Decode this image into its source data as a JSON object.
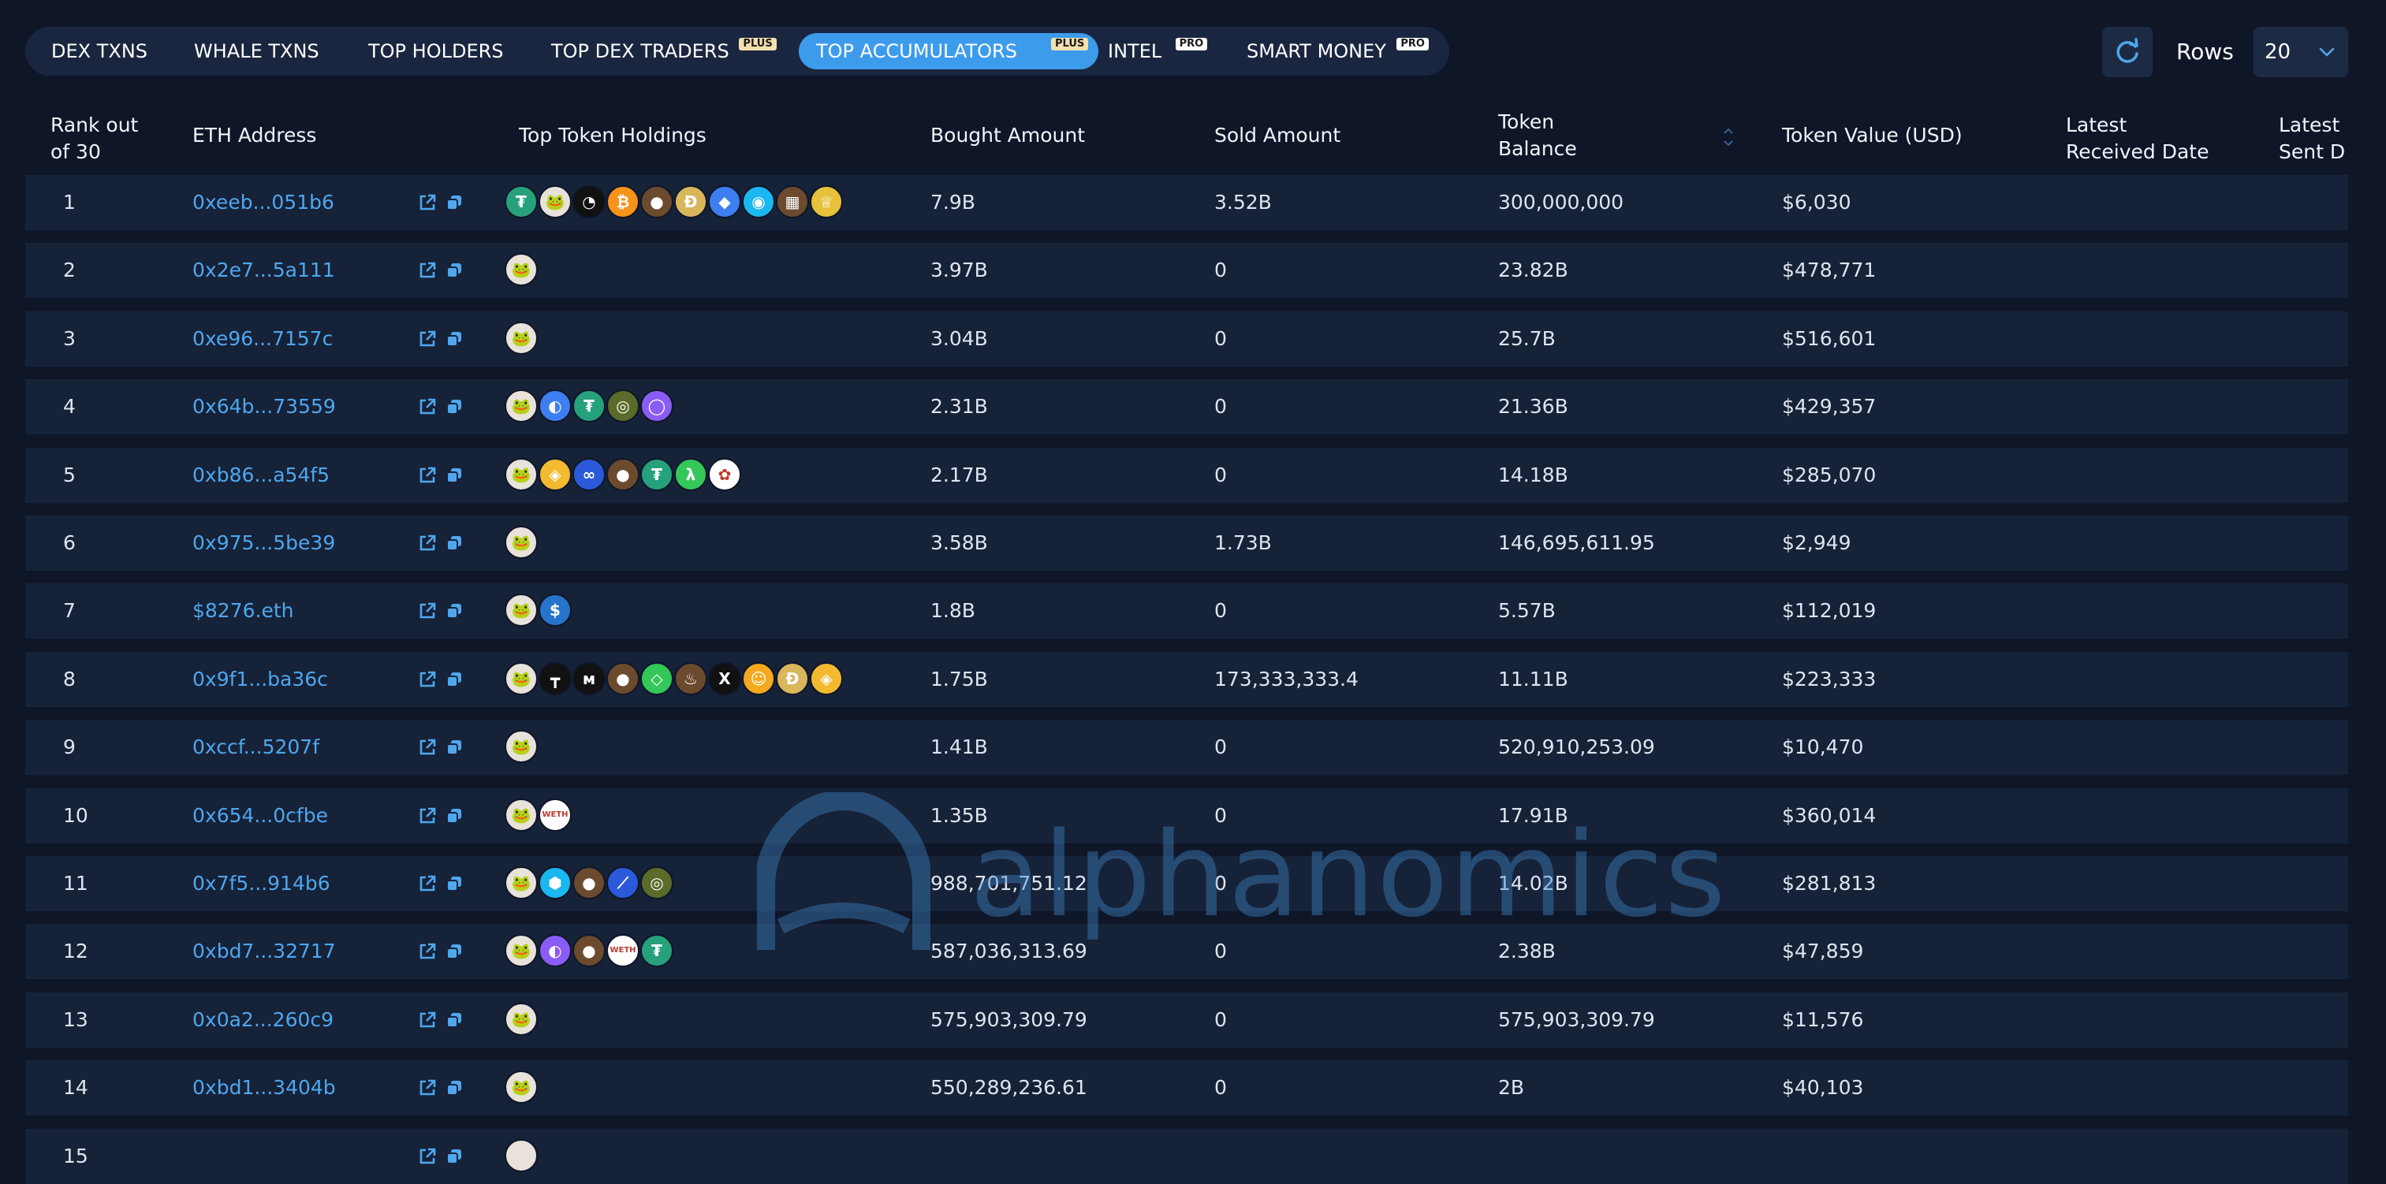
{
  "tabs": [
    {
      "label": "DEX TXNS",
      "badge": "",
      "active": false
    },
    {
      "label": "WHALE TXNS",
      "badge": "",
      "active": false
    },
    {
      "label": "TOP HOLDERS",
      "badge": "",
      "active": false
    },
    {
      "label": "TOP DEX TRADERS",
      "badge": "PLUS",
      "active": false
    },
    {
      "label": "TOP ACCUMULATORS",
      "badge": "PLUS",
      "active": true
    },
    {
      "label": "INTEL",
      "badge": "PRO",
      "active": false
    },
    {
      "label": "SMART MONEY",
      "badge": "PRO",
      "active": false
    }
  ],
  "controls": {
    "refresh_icon": "refresh-icon",
    "rows_label": "Rows",
    "rows_value": "20"
  },
  "columns": {
    "rank": [
      "Rank out",
      "of 30"
    ],
    "address": "ETH Address",
    "holdings": "Top Token Holdings",
    "bought": "Bought Amount",
    "sold": "Sold Amount",
    "balance": [
      "Token",
      "Balance"
    ],
    "value": "Token Value (USD)",
    "received": [
      "Latest",
      "Received Date"
    ],
    "sent": [
      "Latest",
      "Sent D"
    ]
  },
  "icons": {
    "external_link": "external-link-icon",
    "copy": "copy-icon"
  },
  "token_palette": {
    "pepe": "#e8e2da",
    "tether": "#26a17b",
    "bitcoin": "#f7931a",
    "binance": "#f3ba2f",
    "weth": "#ffffff",
    "usdc": "#2775ca",
    "chainlink": "#2a5ada",
    "doge": "#d9b65b",
    "shiba": "#f4a91e",
    "dark": "#111111",
    "blue": "#3d7ff0",
    "cyan": "#1bb7f0",
    "green": "#34c759",
    "purple": "#8a5cf6",
    "olive": "#5a6b2a",
    "brown": "#6b4a2e",
    "gold": "#e7c13a"
  },
  "rows": [
    {
      "rank": "1",
      "address": "0xeeb...051b6",
      "bought": "7.9B",
      "sold": "3.52B",
      "balance": "300,000,000",
      "value": "$6,030",
      "tokens": [
        [
          "tether",
          "₮"
        ],
        [
          "pepe",
          "🐸"
        ],
        [
          "dark",
          "◔"
        ],
        [
          "bitcoin",
          "₿"
        ],
        [
          "brown",
          "●"
        ],
        [
          "doge",
          "Ð"
        ],
        [
          "blue",
          "◆"
        ],
        [
          "cyan",
          "◉"
        ],
        [
          "brown",
          "▦"
        ],
        [
          "gold",
          "♕"
        ]
      ]
    },
    {
      "rank": "2",
      "address": "0x2e7...5a111",
      "bought": "3.97B",
      "sold": "0",
      "balance": "23.82B",
      "value": "$478,771",
      "tokens": [
        [
          "pepe",
          "🐸"
        ]
      ]
    },
    {
      "rank": "3",
      "address": "0xe96...7157c",
      "bought": "3.04B",
      "sold": "0",
      "balance": "25.7B",
      "value": "$516,601",
      "tokens": [
        [
          "pepe",
          "🐸"
        ]
      ]
    },
    {
      "rank": "4",
      "address": "0x64b...73559",
      "bought": "2.31B",
      "sold": "0",
      "balance": "21.36B",
      "value": "$429,357",
      "tokens": [
        [
          "pepe",
          "🐸"
        ],
        [
          "blue",
          "◐"
        ],
        [
          "tether",
          "₮"
        ],
        [
          "olive",
          "◎"
        ],
        [
          "purple",
          "◯"
        ]
      ]
    },
    {
      "rank": "5",
      "address": "0xb86...a54f5",
      "bought": "2.17B",
      "sold": "0",
      "balance": "14.18B",
      "value": "$285,070",
      "tokens": [
        [
          "pepe",
          "🐸"
        ],
        [
          "binance",
          "◈"
        ],
        [
          "chainlink",
          "∞"
        ],
        [
          "brown",
          "●"
        ],
        [
          "tether",
          "₮"
        ],
        [
          "green",
          "λ"
        ],
        [
          "weth",
          "✿"
        ]
      ]
    },
    {
      "rank": "6",
      "address": "0x975...5be39",
      "bought": "3.58B",
      "sold": "1.73B",
      "balance": "146,695,611.95",
      "value": "$2,949",
      "tokens": [
        [
          "pepe",
          "🐸"
        ]
      ]
    },
    {
      "rank": "7",
      "address": "$8276.eth",
      "bought": "1.8B",
      "sold": "0",
      "balance": "5.57B",
      "value": "$112,019",
      "tokens": [
        [
          "pepe",
          "🐸"
        ],
        [
          "usdc",
          "$"
        ]
      ]
    },
    {
      "rank": "8",
      "address": "0x9f1...ba36c",
      "bought": "1.75B",
      "sold": "173,333,333.4",
      "balance": "11.11B",
      "value": "$223,333",
      "tokens": [
        [
          "pepe",
          "🐸"
        ],
        [
          "dark",
          "┳"
        ],
        [
          "dark",
          "ᴍ"
        ],
        [
          "brown",
          "●"
        ],
        [
          "green",
          "◇"
        ],
        [
          "brown",
          "♨"
        ],
        [
          "dark",
          "X"
        ],
        [
          "shiba",
          "☺"
        ],
        [
          "doge",
          "Ð"
        ],
        [
          "binance",
          "◈"
        ]
      ]
    },
    {
      "rank": "9",
      "address": "0xccf...5207f",
      "bought": "1.41B",
      "sold": "0",
      "balance": "520,910,253.09",
      "value": "$10,470",
      "tokens": [
        [
          "pepe",
          "🐸"
        ]
      ]
    },
    {
      "rank": "10",
      "address": "0x654...0cfbe",
      "bought": "1.35B",
      "sold": "0",
      "balance": "17.91B",
      "value": "$360,014",
      "tokens": [
        [
          "pepe",
          "🐸"
        ],
        [
          "weth",
          "WETH"
        ]
      ]
    },
    {
      "rank": "11",
      "address": "0x7f5...914b6",
      "bought": "988,701,751.12",
      "sold": "0",
      "balance": "14.02B",
      "value": "$281,813",
      "tokens": [
        [
          "pepe",
          "🐸"
        ],
        [
          "cyan",
          "⬢"
        ],
        [
          "brown",
          "●"
        ],
        [
          "chainlink",
          "⟋"
        ],
        [
          "olive",
          "◎"
        ]
      ]
    },
    {
      "rank": "12",
      "address": "0xbd7...32717",
      "bought": "587,036,313.69",
      "sold": "0",
      "balance": "2.38B",
      "value": "$47,859",
      "tokens": [
        [
          "pepe",
          "🐸"
        ],
        [
          "purple",
          "◐"
        ],
        [
          "brown",
          "●"
        ],
        [
          "weth",
          "WETH"
        ],
        [
          "tether",
          "₮"
        ]
      ]
    },
    {
      "rank": "13",
      "address": "0x0a2...260c9",
      "bought": "575,903,309.79",
      "sold": "0",
      "balance": "575,903,309.79",
      "value": "$11,576",
      "tokens": [
        [
          "pepe",
          "🐸"
        ]
      ]
    },
    {
      "rank": "14",
      "address": "0xbd1...3404b",
      "bought": "550,289,236.61",
      "sold": "0",
      "balance": "2B",
      "value": "$40,103",
      "tokens": [
        [
          "pepe",
          "🐸"
        ]
      ]
    },
    {
      "rank": "15",
      "address": "",
      "bought": "",
      "sold": "",
      "balance": "",
      "value": "",
      "tokens": [
        [
          "pepe",
          ""
        ]
      ]
    }
  ],
  "watermark": {
    "text": "alphanomics"
  }
}
